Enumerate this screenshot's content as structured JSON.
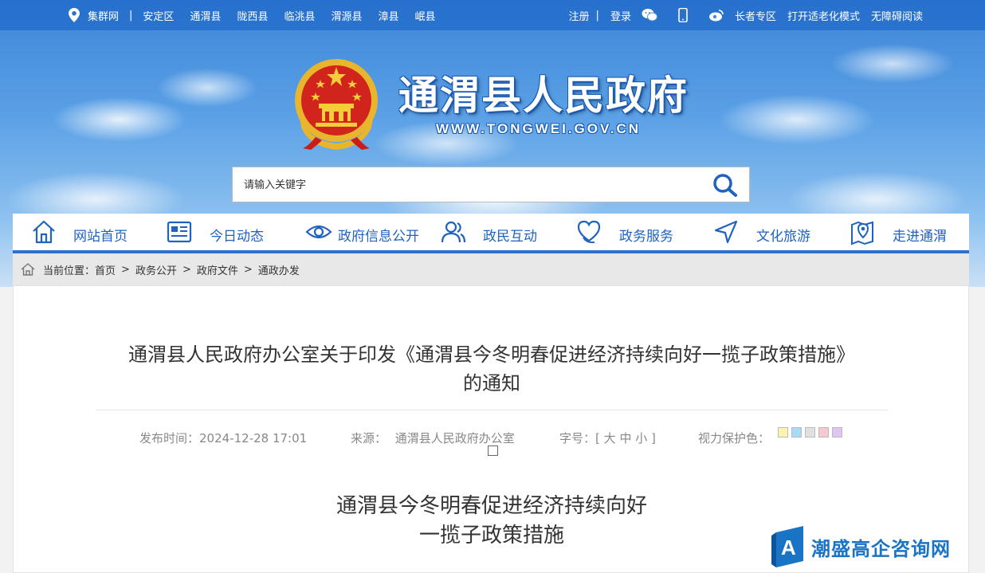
{
  "topbar": {
    "site_group": "集群网",
    "separator": "|",
    "counties": [
      "安定区",
      "通渭县",
      "陇西县",
      "临洮县",
      "渭源县",
      "漳县",
      "岷县"
    ],
    "register": "注册",
    "login": "登录",
    "elder_zone": "长者专区",
    "elderly_mode": "打开适老化模式",
    "accessible_reading": "无障碍阅读"
  },
  "header": {
    "title": "通渭县人民政府",
    "url": "WWW.TONGWEI.GOV.CN"
  },
  "search": {
    "placeholder": "请输入关键字"
  },
  "nav": {
    "items": [
      {
        "label": "网站首页",
        "icon": "home-icon"
      },
      {
        "label": "今日动态",
        "icon": "news-icon"
      },
      {
        "label": "政府信息公开",
        "icon": "eye-icon"
      },
      {
        "label": "政民互动",
        "icon": "people-icon"
      },
      {
        "label": "政务服务",
        "icon": "heart-hand-icon"
      },
      {
        "label": "文化旅游",
        "icon": "navigation-icon"
      },
      {
        "label": "走进通渭",
        "icon": "map-pin-icon"
      }
    ]
  },
  "breadcrumb": {
    "prefix": "当前位置：",
    "items": [
      "首页",
      "政务公开",
      "政府文件",
      "通政办发"
    ],
    "arrow": ">"
  },
  "article": {
    "title_line1": "通渭县人民政府办公室关于印发《通渭县今冬明春促进经济持续向好一揽子政策措施》",
    "title_line2": "的通知",
    "publish_label": "发布时间：",
    "publish_time": "2024-12-28 17:01",
    "source_label": "来源：",
    "source": "通渭县人民政府办公室",
    "font_label": "字号：",
    "font_open": "[",
    "font_large": "大",
    "font_medium": "中",
    "font_small": "小",
    "font_close": "]",
    "eye_label": "视力保护色：",
    "eye_colors": [
      "#fbf3b0",
      "#a6dcf5",
      "#e0e0e0",
      "#f7c7d2",
      "#e0c4f2"
    ],
    "subtitle_line1": "通渭县今冬明春促进经济持续向好",
    "subtitle_line2": "一揽子政策措施"
  },
  "watermark": {
    "text": "潮盛高企咨询网"
  },
  "colors": {
    "brand_blue": "#1f62c0",
    "nav_border": "#2b72d0"
  }
}
